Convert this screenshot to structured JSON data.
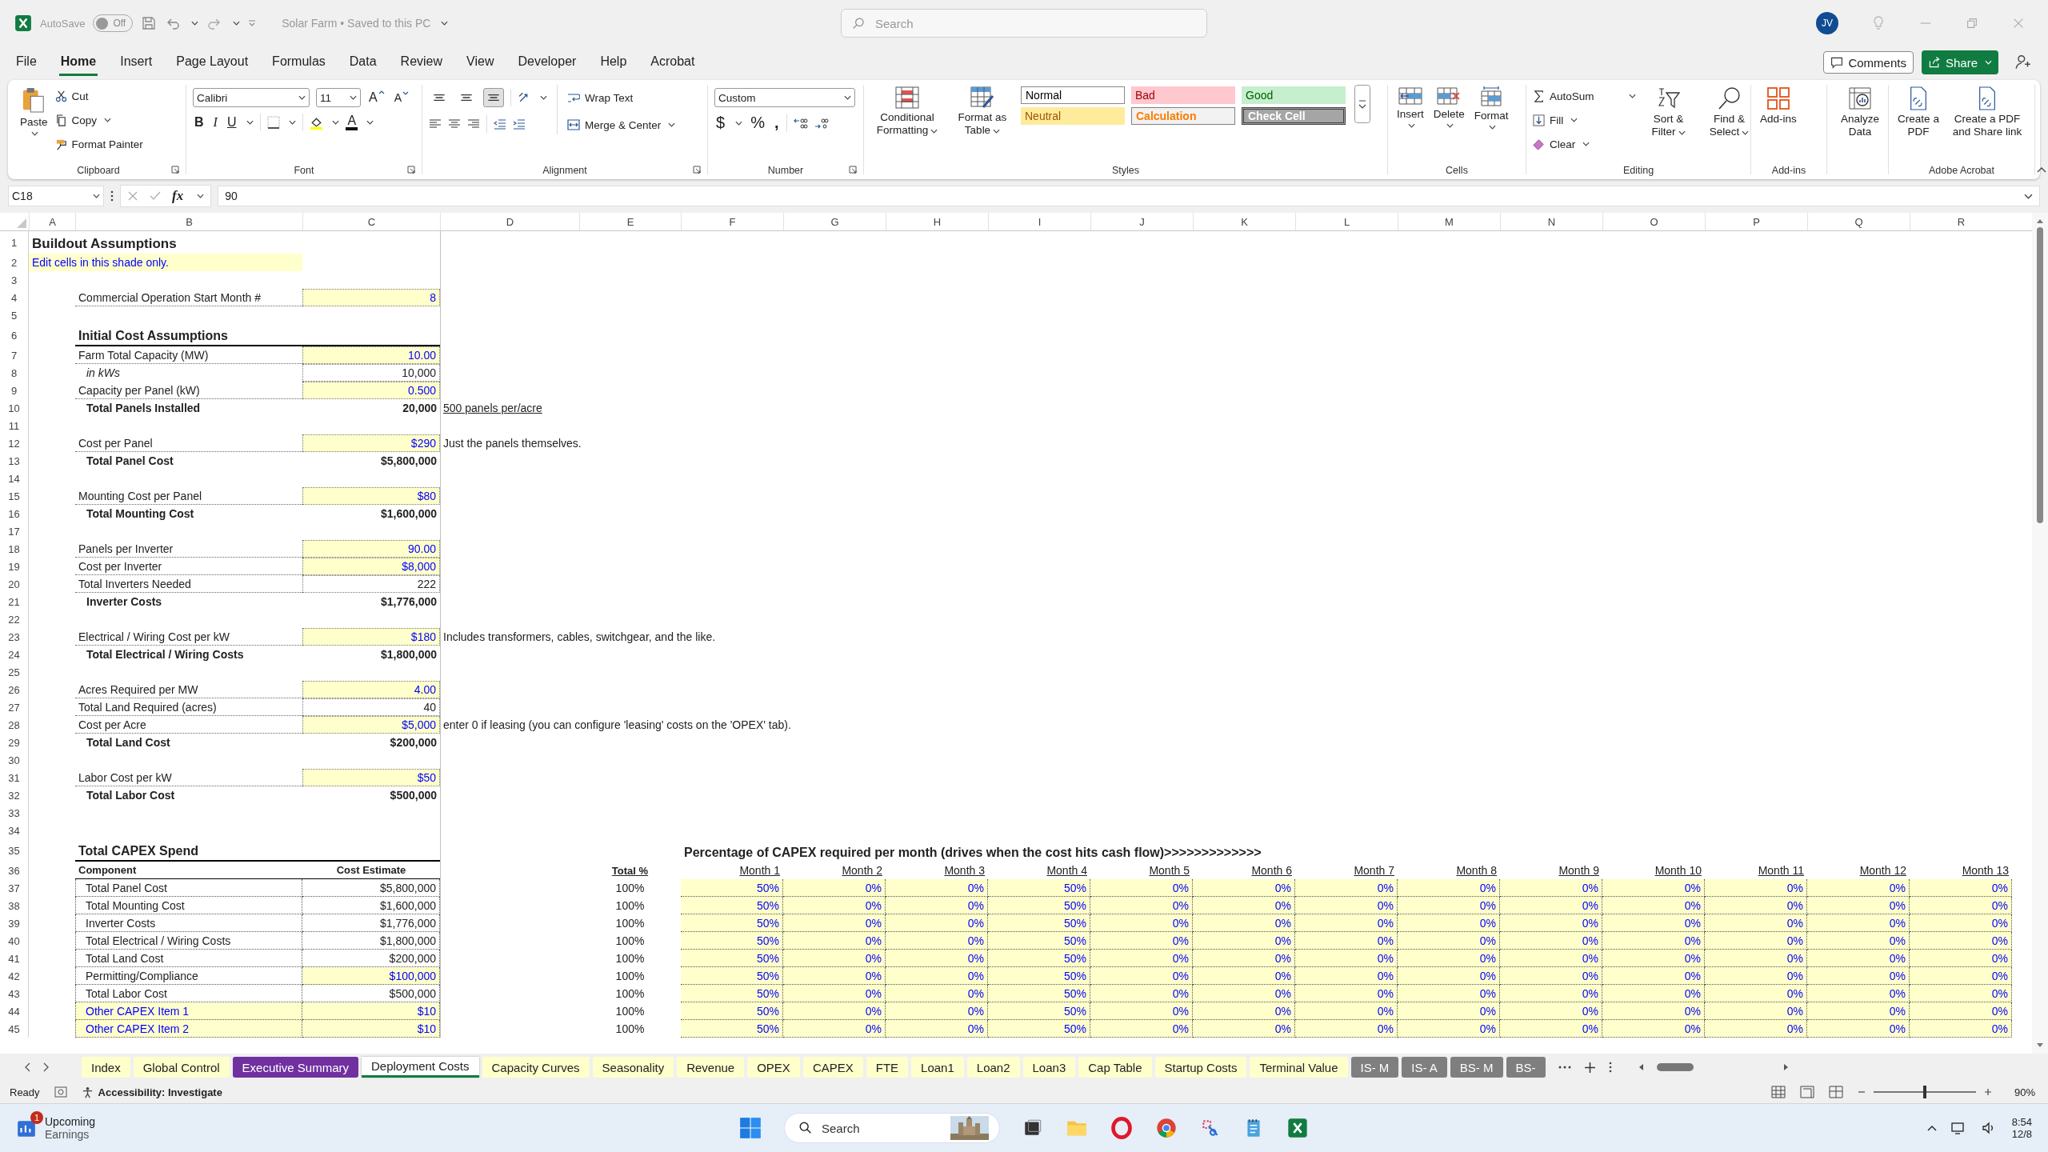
{
  "title_bar": {
    "autosave_label": "AutoSave",
    "autosave": {
      "on": false,
      "label": "Off"
    },
    "document_title": "Solar Farm • Saved to this PC",
    "search_placeholder": "Search",
    "user_initials": "JV"
  },
  "menu_tabs": [
    {
      "label": "File",
      "selected": false
    },
    {
      "label": "Home",
      "selected": true
    },
    {
      "label": "Insert",
      "selected": false
    },
    {
      "label": "Page Layout",
      "selected": false
    },
    {
      "label": "Formulas",
      "selected": false
    },
    {
      "label": "Data",
      "selected": false
    },
    {
      "label": "Review",
      "selected": false
    },
    {
      "label": "View",
      "selected": false
    },
    {
      "label": "Developer",
      "selected": false
    },
    {
      "label": "Help",
      "selected": false
    },
    {
      "label": "Acrobat",
      "selected": false
    }
  ],
  "comments_button": "Comments",
  "share_button": "Share",
  "ribbon": {
    "clipboard": {
      "label": "Clipboard",
      "paste": "Paste",
      "cut": "Cut",
      "copy": "Copy",
      "format_painter": "Format Painter"
    },
    "font": {
      "label": "Font",
      "family": "Calibri",
      "size": "11",
      "grow": "A",
      "shrink": "A",
      "bold": "B",
      "italic": "I",
      "underline": "U",
      "text_color_button": "A"
    },
    "alignment": {
      "label": "Alignment",
      "vertical": [
        {
          "pressed": false
        },
        {
          "pressed": false
        },
        {
          "pressed": true
        }
      ],
      "wrap_text": "Wrap Text",
      "merge_center": "Merge & Center"
    },
    "number": {
      "label": "Number",
      "format": "Custom",
      "currency": "$",
      "percent": "%",
      "comma": ","
    },
    "styles": {
      "label": "Styles",
      "conditional_formatting": "Conditional Formatting",
      "format_as_table": "Format as Table",
      "cell_styles": [
        {
          "label": "Normal",
          "kind": "normal"
        },
        {
          "label": "Bad",
          "kind": "bad"
        },
        {
          "label": "Good",
          "kind": "good"
        },
        {
          "label": "Neutral",
          "kind": "neutral"
        },
        {
          "label": "Calculation",
          "kind": "calculation"
        },
        {
          "label": "Check Cell",
          "kind": "check"
        }
      ]
    },
    "cells": {
      "label": "Cells",
      "insert": "Insert",
      "delete": "Delete",
      "format": "Format"
    },
    "editing": {
      "label": "Editing",
      "autosum": "AutoSum",
      "fill": "Fill",
      "clear": "Clear",
      "sort_filter": "Sort & Filter",
      "find_select": "Find & Select"
    },
    "add_ins": {
      "label": "Add-ins",
      "button": "Add-ins"
    },
    "analyze_data": "Analyze Data",
    "acrobat": {
      "label": "Adobe Acrobat",
      "create_pdf": "Create a PDF",
      "create_share": "Create a PDF and Share link"
    }
  },
  "formula_bar": {
    "name_box": "C18",
    "function_label": "fx",
    "value": "90"
  },
  "columns": [
    "A",
    "B",
    "C",
    "D",
    "E",
    "F",
    "G",
    "H",
    "I",
    "J",
    "K",
    "L",
    "M",
    "N",
    "O",
    "P",
    "Q",
    "R"
  ],
  "assumption_rows": [
    {
      "number": "1",
      "kind": "title",
      "text": "Buildout Assumptions"
    },
    {
      "number": "2",
      "kind": "note",
      "text": "Edit cells in this shade only."
    },
    {
      "number": "3",
      "kind": "blank"
    },
    {
      "number": "4",
      "kind": "input",
      "label": "Commercial Operation Start Month #",
      "value": "8"
    },
    {
      "number": "5",
      "kind": "blank"
    },
    {
      "number": "6",
      "kind": "heading",
      "text": "Initial Cost Assumptions"
    },
    {
      "number": "7",
      "kind": "input",
      "label": "Farm Total Capacity (MW)",
      "value": "10.00"
    },
    {
      "number": "8",
      "kind": "sub",
      "label": "in kWs",
      "value": "10,000"
    },
    {
      "number": "9",
      "kind": "input",
      "label": "Capacity per Panel (kW)",
      "value": "0.500"
    },
    {
      "number": "10",
      "kind": "total",
      "label": "Total Panels Installed",
      "value": "20,000",
      "comment": "500 panels per/acre",
      "comment_underlined": true
    },
    {
      "number": "11",
      "kind": "blank"
    },
    {
      "number": "12",
      "kind": "input",
      "label": "Cost per Panel",
      "value": "$290",
      "comment": "Just the panels themselves."
    },
    {
      "number": "13",
      "kind": "total",
      "label": "Total Panel Cost",
      "value": "$5,800,000"
    },
    {
      "number": "14",
      "kind": "blank"
    },
    {
      "number": "15",
      "kind": "input",
      "label": "Mounting Cost per Panel",
      "value": "$80"
    },
    {
      "number": "16",
      "kind": "total",
      "label": "Total Mounting Cost",
      "value": "$1,600,000"
    },
    {
      "number": "17",
      "kind": "blank"
    },
    {
      "number": "18",
      "kind": "input",
      "label": "Panels per Inverter",
      "value": "90.00"
    },
    {
      "number": "19",
      "kind": "input",
      "label": "Cost per Inverter",
      "value": "$8,000"
    },
    {
      "number": "20",
      "kind": "calc",
      "label": "Total Inverters Needed",
      "value": "222"
    },
    {
      "number": "21",
      "kind": "total",
      "label": "Inverter Costs",
      "value": "$1,776,000"
    },
    {
      "number": "22",
      "kind": "blank"
    },
    {
      "number": "23",
      "kind": "input",
      "label": "Electrical / Wiring Cost per kW",
      "value": "$180",
      "comment": "Includes transformers, cables, switchgear, and the like."
    },
    {
      "number": "24",
      "kind": "total",
      "label": "Total Electrical / Wiring Costs",
      "value": "$1,800,000"
    },
    {
      "number": "25",
      "kind": "blank"
    },
    {
      "number": "26",
      "kind": "input",
      "label": "Acres Required per MW",
      "value": "4.00"
    },
    {
      "number": "27",
      "kind": "calc",
      "label": "Total Land Required (acres)",
      "value": "40"
    },
    {
      "number": "28",
      "kind": "input",
      "label": "Cost per Acre",
      "value": "$5,000",
      "comment": "enter 0 if leasing (you can configure 'leasing' costs on the 'OPEX' tab)."
    },
    {
      "number": "29",
      "kind": "total",
      "label": "Total Land Cost",
      "value": "$200,000"
    },
    {
      "number": "30",
      "kind": "blank"
    },
    {
      "number": "31",
      "kind": "input",
      "label": "Labor Cost per kW",
      "value": "$50"
    },
    {
      "number": "32",
      "kind": "total",
      "label": "Total Labor Cost",
      "value": "$500,000"
    },
    {
      "number": "33",
      "kind": "blank"
    },
    {
      "number": "34",
      "kind": "blank"
    }
  ],
  "capex": {
    "title_number": "35",
    "title": "Total CAPEX Spend",
    "banner": "Percentage of CAPEX required per month (drives when the cost hits cash flow)>>>>>>>>>>>>>",
    "header_number": "36",
    "component_header": "Component",
    "cost_header": "Cost Estimate",
    "total_header": "Total %",
    "month_headers": [
      "Month 1",
      "Month 2",
      "Month 3",
      "Month 4",
      "Month 5",
      "Month 6",
      "Month 7",
      "Month 8",
      "Month 9",
      "Month 10",
      "Month 11",
      "Month 12",
      "Month 13"
    ],
    "rows": [
      {
        "number": "37",
        "component": "Total Panel Cost",
        "component_input": false,
        "cost": "$5,800,000",
        "cost_input": false,
        "total": "100%",
        "months": [
          "50%",
          "0%",
          "0%",
          "50%",
          "0%",
          "0%",
          "0%",
          "0%",
          "0%",
          "0%",
          "0%",
          "0%",
          "0%"
        ]
      },
      {
        "number": "38",
        "component": "Total Mounting Cost",
        "component_input": false,
        "cost": "$1,600,000",
        "cost_input": false,
        "total": "100%",
        "months": [
          "50%",
          "0%",
          "0%",
          "50%",
          "0%",
          "0%",
          "0%",
          "0%",
          "0%",
          "0%",
          "0%",
          "0%",
          "0%"
        ]
      },
      {
        "number": "39",
        "component": "Inverter Costs",
        "component_input": false,
        "cost": "$1,776,000",
        "cost_input": false,
        "total": "100%",
        "months": [
          "50%",
          "0%",
          "0%",
          "50%",
          "0%",
          "0%",
          "0%",
          "0%",
          "0%",
          "0%",
          "0%",
          "0%",
          "0%"
        ]
      },
      {
        "number": "40",
        "component": "Total Electrical / Wiring Costs",
        "component_input": false,
        "cost": "$1,800,000",
        "cost_input": false,
        "total": "100%",
        "months": [
          "50%",
          "0%",
          "0%",
          "50%",
          "0%",
          "0%",
          "0%",
          "0%",
          "0%",
          "0%",
          "0%",
          "0%",
          "0%"
        ]
      },
      {
        "number": "41",
        "component": "Total Land Cost",
        "component_input": false,
        "cost": "$200,000",
        "cost_input": false,
        "total": "100%",
        "months": [
          "50%",
          "0%",
          "0%",
          "50%",
          "0%",
          "0%",
          "0%",
          "0%",
          "0%",
          "0%",
          "0%",
          "0%",
          "0%"
        ]
      },
      {
        "number": "42",
        "component": "Permitting/Compliance",
        "component_input": false,
        "cost": "$100,000",
        "cost_input": true,
        "total": "100%",
        "months": [
          "50%",
          "0%",
          "0%",
          "50%",
          "0%",
          "0%",
          "0%",
          "0%",
          "0%",
          "0%",
          "0%",
          "0%",
          "0%"
        ]
      },
      {
        "number": "43",
        "component": "Total Labor Cost",
        "component_input": false,
        "cost": "$500,000",
        "cost_input": false,
        "total": "100%",
        "months": [
          "50%",
          "0%",
          "0%",
          "50%",
          "0%",
          "0%",
          "0%",
          "0%",
          "0%",
          "0%",
          "0%",
          "0%",
          "0%"
        ]
      },
      {
        "number": "44",
        "component": "Other CAPEX Item 1",
        "component_input": true,
        "cost": "$10",
        "cost_input": true,
        "total": "100%",
        "months": [
          "50%",
          "0%",
          "0%",
          "50%",
          "0%",
          "0%",
          "0%",
          "0%",
          "0%",
          "0%",
          "0%",
          "0%",
          "0%"
        ]
      },
      {
        "number": "45",
        "component": "Other CAPEX Item 2",
        "component_input": true,
        "cost": "$10",
        "cost_input": true,
        "total": "100%",
        "months": [
          "50%",
          "0%",
          "0%",
          "50%",
          "0%",
          "0%",
          "0%",
          "0%",
          "0%",
          "0%",
          "0%",
          "0%",
          "0%"
        ]
      }
    ]
  },
  "sheet_tabs": [
    {
      "label": "Index",
      "selected": false,
      "color": "#ffffcc"
    },
    {
      "label": "Global Control",
      "selected": false,
      "color": "#ffffcc"
    },
    {
      "label": "Executive Summary",
      "selected": false,
      "color": "#7030a0"
    },
    {
      "label": "Deployment Costs",
      "selected": true
    },
    {
      "label": "Capacity Curves",
      "selected": false,
      "color": "#ffffcc"
    },
    {
      "label": "Seasonality",
      "selected": false,
      "color": "#ffffcc"
    },
    {
      "label": "Revenue",
      "selected": false,
      "color": "#ffffcc"
    },
    {
      "label": "OPEX",
      "selected": false,
      "color": "#ffffcc"
    },
    {
      "label": "CAPEX",
      "selected": false,
      "color": "#ffffcc"
    },
    {
      "label": "FTE",
      "selected": false,
      "color": "#ffffcc"
    },
    {
      "label": "Loan1",
      "selected": false,
      "color": "#ffffcc"
    },
    {
      "label": "Loan2",
      "selected": false,
      "color": "#ffffcc"
    },
    {
      "label": "Loan3",
      "selected": false,
      "color": "#ffffcc"
    },
    {
      "label": "Cap Table",
      "selected": false,
      "color": "#ffffcc"
    },
    {
      "label": "Startup Costs",
      "selected": false,
      "color": "#ffffcc"
    },
    {
      "label": "Terminal Value",
      "selected": false,
      "color": "#ffffcc"
    },
    {
      "label": "IS- M",
      "selected": false,
      "color": "#7f7f7f"
    },
    {
      "label": "IS- A",
      "selected": false,
      "color": "#7f7f7f"
    },
    {
      "label": "BS- M",
      "selected": false,
      "color": "#7f7f7f"
    },
    {
      "label": "BS-",
      "selected": false,
      "color": "#7f7f7f"
    }
  ],
  "status_bar": {
    "mode": "Ready",
    "accessibility": "Accessibility: Investigate",
    "zoom": "90%",
    "zoom_slider": {
      "level": 0.5
    }
  },
  "taskbar": {
    "widget_badge": "1",
    "widget_title": "Upcoming",
    "widget_subtitle": "Earnings",
    "search_placeholder": "Search",
    "time": "8:54",
    "date": "12/8"
  }
}
